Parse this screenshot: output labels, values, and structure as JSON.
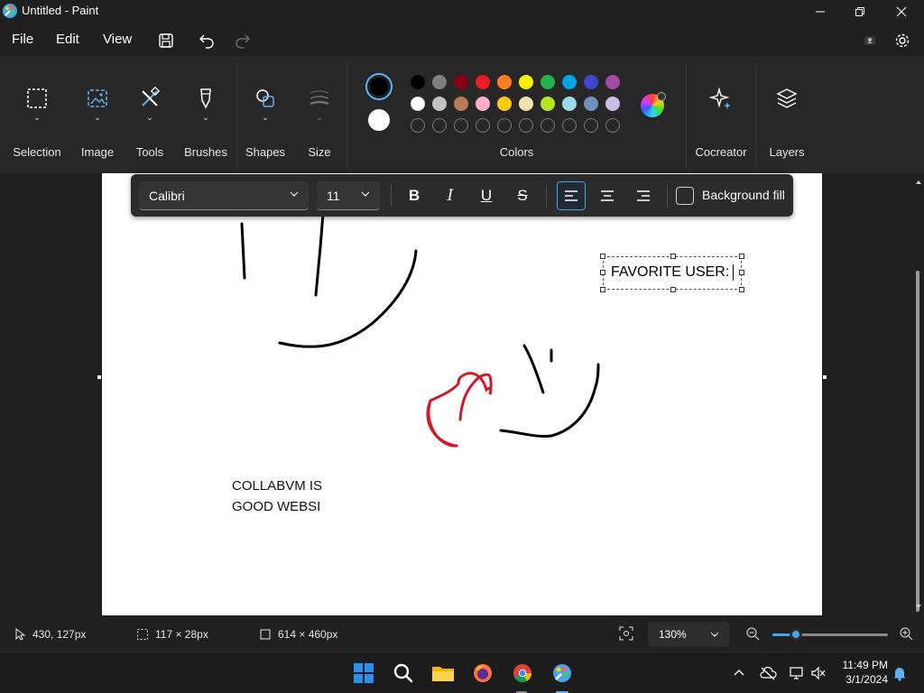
{
  "window": {
    "title": "Untitled - Paint"
  },
  "menu": {
    "file": "File",
    "edit": "Edit",
    "view": "View"
  },
  "ribbon": {
    "groups": {
      "selection": "Selection",
      "image": "Image",
      "tools": "Tools",
      "brushes": "Brushes",
      "shapes": "Shapes",
      "size": "Size",
      "colors": "Colors",
      "cocreator": "Cocreator",
      "layers": "Layers"
    },
    "primary_color": "#000000",
    "secondary_color": "#ffffff",
    "palette_row1": [
      "#000000",
      "#7f7f7f",
      "#880015",
      "#ed1c24",
      "#ff7f27",
      "#fff200",
      "#22b14c",
      "#00a2e8",
      "#3f48cc",
      "#a349a4"
    ],
    "palette_row2": [
      "#ffffff",
      "#c3c3c3",
      "#b97a57",
      "#ffaec9",
      "#ffc90e",
      "#efe4b0",
      "#b5e61d",
      "#99d9ea",
      "#7092be",
      "#c8bfe7"
    ],
    "palette_row3_empty_count": 10
  },
  "text_toolbar": {
    "font": "Calibri",
    "size": "11",
    "bold": "B",
    "italic": "I",
    "underline": "U",
    "strikethrough": "S",
    "background_fill": "Background fill",
    "alignment": "left"
  },
  "canvas": {
    "text_box": "FAVORITE USER:",
    "text_line1": "COLLABVM IS",
    "text_line2": "GOOD WEBSI"
  },
  "status": {
    "cursor": "430, 127px",
    "selection": "117 × 28px",
    "canvas_size": "614 × 460px",
    "zoom": "130%",
    "zoom_fraction": 0.2
  },
  "taskbar": {
    "time": "11:49 PM",
    "date": "3/1/2024"
  }
}
